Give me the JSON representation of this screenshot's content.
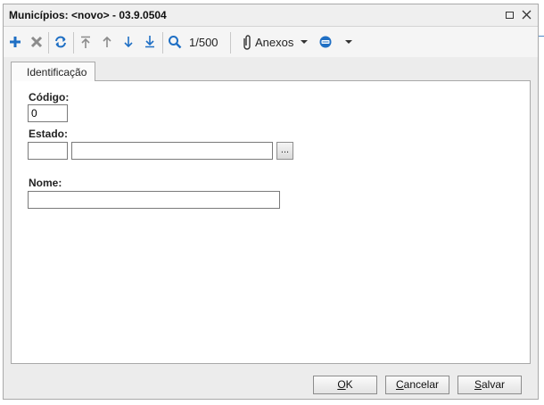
{
  "window": {
    "title": "Municípios: <novo> - 03.9.0504",
    "controls": {
      "maximize_icon": "maximize-icon",
      "close_icon": "close-icon"
    }
  },
  "toolbar": {
    "icons": [
      "plus-icon",
      "delete-icon",
      "refresh-icon",
      "first-record-icon",
      "previous-record-icon",
      "next-record-icon",
      "last-record-icon",
      "search-icon"
    ],
    "pager": "1/500",
    "attachments_label": "Anexos",
    "colors": {
      "add": "#1f6fc4",
      "delete": "#8c8c8c",
      "nav": "#1f6fc4"
    }
  },
  "tabs": [
    {
      "label": "Identificação",
      "active": true
    }
  ],
  "form": {
    "codigo": {
      "label": "Código:",
      "value": "0"
    },
    "estado": {
      "label": "Estado:",
      "code_value": "",
      "name_value": "",
      "lookup_label": "..."
    },
    "nome": {
      "label": "Nome:",
      "value": ""
    }
  },
  "buttons": {
    "ok": {
      "accel": "O",
      "rest": "K"
    },
    "cancel": {
      "accel": "C",
      "rest": "ancelar"
    },
    "save": {
      "accel": "S",
      "rest": "alvar"
    }
  }
}
